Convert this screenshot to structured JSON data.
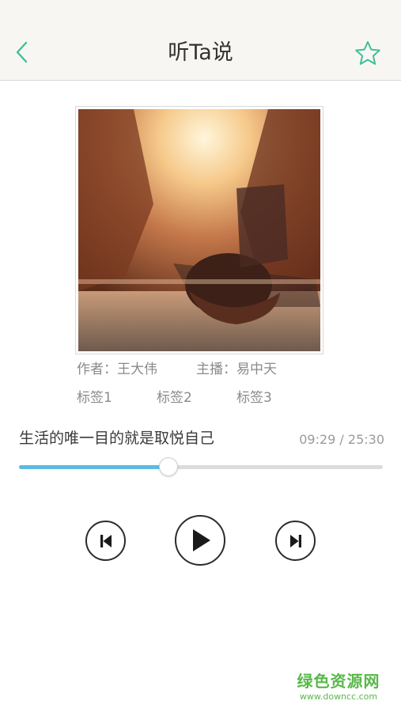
{
  "header": {
    "title": "听Ta说",
    "back_icon": "chevron-left-icon",
    "favorite_icon": "star-outline-icon",
    "accent_color": "#3fbf9a",
    "background": "#f8f6f3"
  },
  "album": {
    "cover_description_icon": "cover-art-image",
    "author": "作者：王大伟",
    "host": "主播：易中天",
    "tags": [
      "标签1",
      "标签2",
      "标签3"
    ]
  },
  "player": {
    "track_title": "生活的唯一目的就是取悦自己",
    "time_readout": "09:29 / 25:30",
    "elapsed": "09:29",
    "duration": "25:30",
    "progress_fraction": 0.41,
    "progress_color": "#5bbbe0",
    "controls": {
      "prev_icon": "skip-previous-icon",
      "play_icon": "play-icon",
      "next_icon": "skip-next-icon"
    }
  },
  "watermark": {
    "name": "绿色资源网",
    "url": "www.downcc.com",
    "color": "#59b84a"
  }
}
